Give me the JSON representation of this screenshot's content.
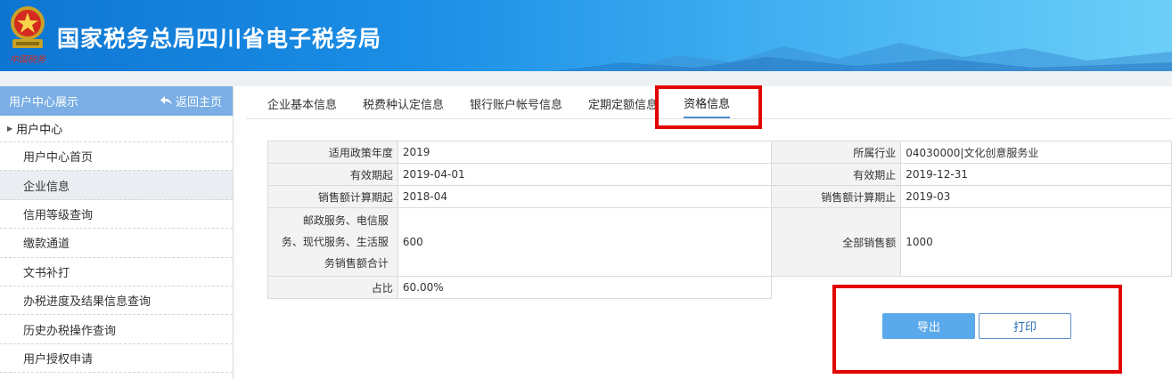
{
  "header": {
    "site_title": "国家税务总局四川省电子税务局",
    "emblem_caption": "中国税务"
  },
  "sidebar": {
    "title": "用户中心展示",
    "back_label": "返回主页",
    "root_label": "用户中心",
    "items": [
      {
        "label": "用户中心首页"
      },
      {
        "label": "企业信息",
        "active": true
      },
      {
        "label": "信用等级查询"
      },
      {
        "label": "缴款通道"
      },
      {
        "label": "文书补打"
      },
      {
        "label": "办税进度及结果信息查询"
      },
      {
        "label": "历史办税操作查询"
      },
      {
        "label": "用户授权申请"
      }
    ]
  },
  "tabs": [
    {
      "label": "企业基本信息"
    },
    {
      "label": "税费种认定信息"
    },
    {
      "label": "银行账户帐号信息"
    },
    {
      "label": "定期定额信息"
    },
    {
      "label": "资格信息",
      "active": true
    }
  ],
  "info": {
    "policy_year_label": "适用政策年度",
    "policy_year": "2019",
    "industry_label": "所属行业",
    "industry": "04030000|文化创意服务业",
    "valid_from_label": "有效期起",
    "valid_from": "2019-04-01",
    "valid_to_label": "有效期止",
    "valid_to": "2019-12-31",
    "sales_start_label": "销售额计算期起",
    "sales_start": "2018-04",
    "sales_end_label": "销售额计算期止",
    "sales_end": "2019-03",
    "service_sales_label_1": "邮政服务、电信服",
    "service_sales_label_2": "务、现代服务、生活服",
    "service_sales_label_3": "务销售额合计",
    "service_sales": "600",
    "total_sales_label": "全部销售额",
    "total_sales": "1000",
    "ratio_label": "占比",
    "ratio": "60.00%"
  },
  "buttons": {
    "export_label": "导出",
    "print_label": "打印"
  },
  "colors": {
    "highlight": "#e20000",
    "accent": "#5aa9ea"
  }
}
